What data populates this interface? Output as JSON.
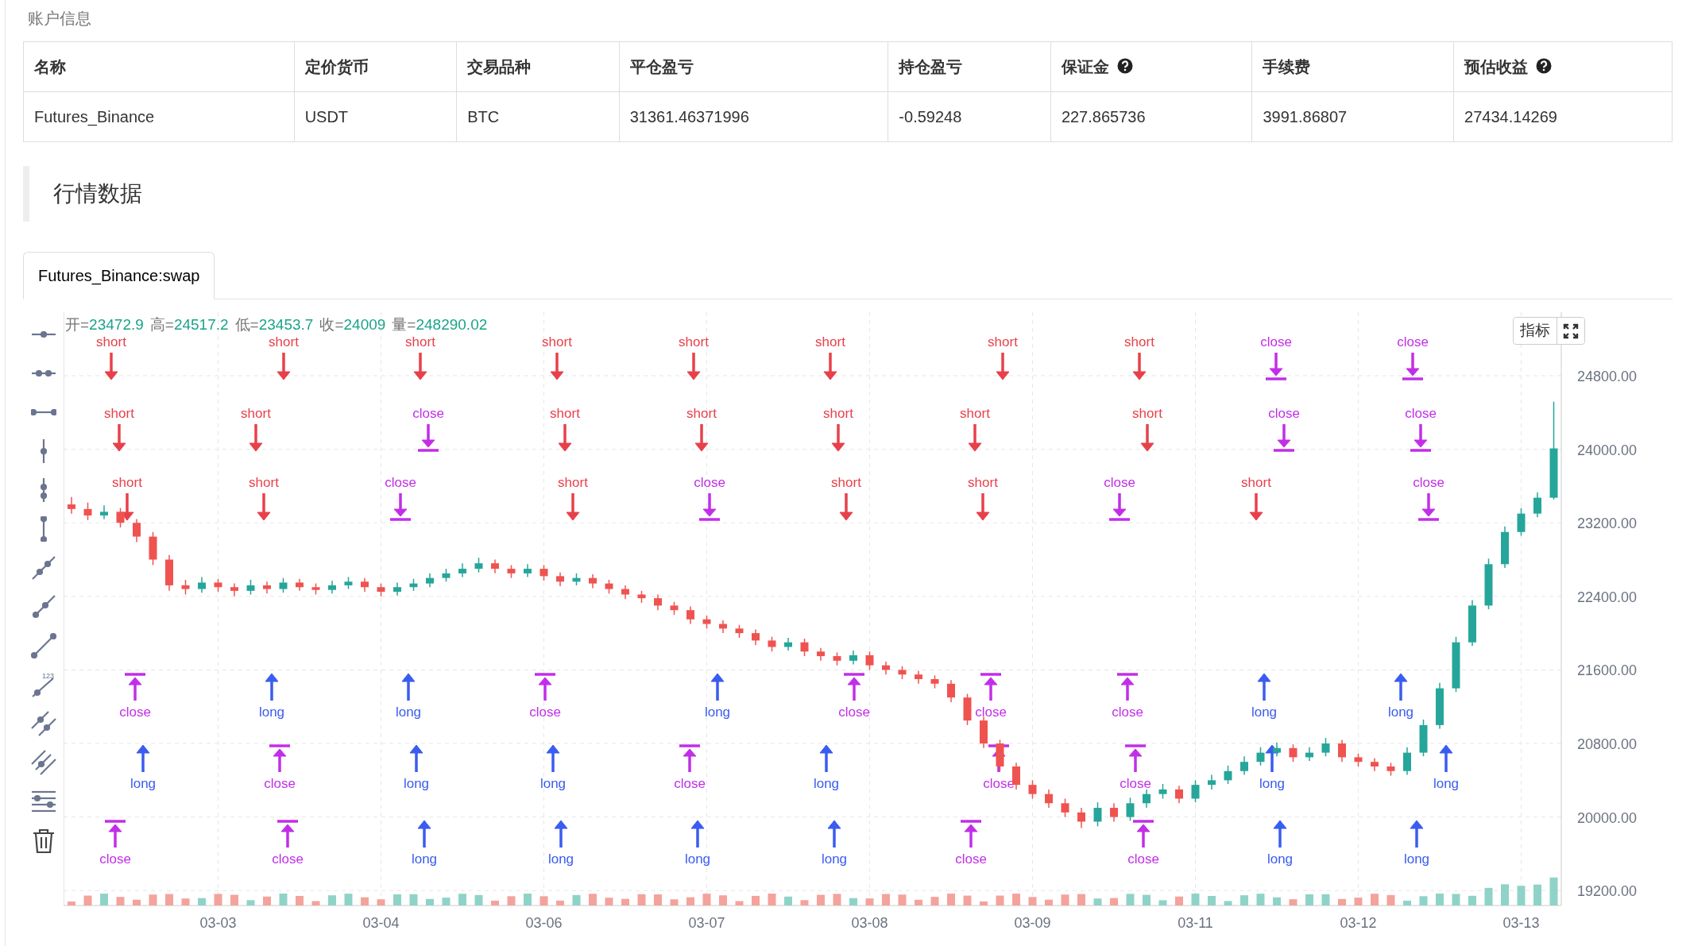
{
  "account": {
    "title": "账户信息",
    "columns": [
      {
        "label": "名称",
        "help": false
      },
      {
        "label": "定价货币",
        "help": false
      },
      {
        "label": "交易品种",
        "help": false
      },
      {
        "label": "平仓盈亏",
        "help": false
      },
      {
        "label": "持仓盈亏",
        "help": false
      },
      {
        "label": "保证金",
        "help": true
      },
      {
        "label": "手续费",
        "help": false
      },
      {
        "label": "预估收益",
        "help": true
      }
    ],
    "rows": [
      [
        "Futures_Binance",
        "USDT",
        "BTC",
        "31361.46371996",
        "-0.59248",
        "227.865736",
        "3991.86807",
        "27434.14269"
      ]
    ]
  },
  "market": {
    "title": "行情数据",
    "tabs": [
      {
        "label": "Futures_Binance:swap",
        "selected": true
      }
    ],
    "toolbar": {
      "fib_label": "123"
    },
    "indicator_button": "指标",
    "legend": [
      {
        "label": "开=",
        "value": "23472.9"
      },
      {
        "label": "高=",
        "value": "24517.2"
      },
      {
        "label": "低=",
        "value": "23453.7"
      },
      {
        "label": "收=",
        "value": "24009"
      },
      {
        "label": "量=",
        "value": "248290.02"
      }
    ],
    "chart_data": {
      "type": "candlestick",
      "categories": [
        null,
        null,
        null,
        null,
        null,
        null,
        null,
        null,
        null,
        "03-03",
        null,
        null,
        null,
        null,
        null,
        null,
        null,
        null,
        null,
        "03-04",
        null,
        null,
        null,
        null,
        null,
        null,
        null,
        null,
        null,
        "03-06",
        null,
        null,
        null,
        null,
        null,
        null,
        null,
        null,
        null,
        "03-07",
        null,
        null,
        null,
        null,
        null,
        null,
        null,
        null,
        null,
        "03-08",
        null,
        null,
        null,
        null,
        null,
        null,
        null,
        null,
        null,
        "03-09",
        null,
        null,
        null,
        null,
        null,
        null,
        null,
        null,
        null,
        "03-11",
        null,
        null,
        null,
        null,
        null,
        null,
        null,
        null,
        null,
        "03-12",
        null,
        null,
        null,
        null,
        null,
        null,
        null,
        null,
        null,
        "03-13",
        null,
        null
      ],
      "ylim": [
        19038,
        25491
      ],
      "grid": true,
      "ohlc": [
        [
          23400,
          23480,
          23300,
          23350
        ],
        [
          23350,
          23420,
          23230,
          23280
        ],
        [
          23280,
          23390,
          23240,
          23320
        ],
        [
          23320,
          23360,
          23150,
          23200
        ],
        [
          23200,
          23240,
          22990,
          23050
        ],
        [
          23050,
          23100,
          22740,
          22800
        ],
        [
          22800,
          22850,
          22460,
          22520
        ],
        [
          22520,
          22580,
          22420,
          22480
        ],
        [
          22480,
          22610,
          22440,
          22550
        ],
        [
          22550,
          22590,
          22450,
          22500
        ],
        [
          22500,
          22540,
          22400,
          22460
        ],
        [
          22460,
          22580,
          22420,
          22520
        ],
        [
          22520,
          22560,
          22430,
          22480
        ],
        [
          22480,
          22600,
          22440,
          22550
        ],
        [
          22550,
          22590,
          22460,
          22500
        ],
        [
          22500,
          22540,
          22420,
          22470
        ],
        [
          22470,
          22570,
          22430,
          22520
        ],
        [
          22520,
          22610,
          22480,
          22560
        ],
        [
          22560,
          22600,
          22450,
          22500
        ],
        [
          22500,
          22540,
          22400,
          22450
        ],
        [
          22450,
          22550,
          22410,
          22500
        ],
        [
          22500,
          22590,
          22460,
          22540
        ],
        [
          22540,
          22650,
          22500,
          22600
        ],
        [
          22600,
          22700,
          22560,
          22650
        ],
        [
          22650,
          22760,
          22610,
          22700
        ],
        [
          22700,
          22820,
          22660,
          22760
        ],
        [
          22760,
          22800,
          22650,
          22700
        ],
        [
          22700,
          22740,
          22600,
          22650
        ],
        [
          22650,
          22750,
          22610,
          22700
        ],
        [
          22700,
          22740,
          22570,
          22620
        ],
        [
          22620,
          22660,
          22510,
          22560
        ],
        [
          22560,
          22650,
          22520,
          22600
        ],
        [
          22600,
          22640,
          22490,
          22540
        ],
        [
          22540,
          22580,
          22430,
          22480
        ],
        [
          22480,
          22520,
          22370,
          22420
        ],
        [
          22420,
          22460,
          22330,
          22380
        ],
        [
          22380,
          22420,
          22250,
          22300
        ],
        [
          22300,
          22340,
          22200,
          22250
        ],
        [
          22250,
          22290,
          22100,
          22150
        ],
        [
          22150,
          22190,
          22050,
          22100
        ],
        [
          22100,
          22140,
          22000,
          22050
        ],
        [
          22050,
          22090,
          21950,
          22000
        ],
        [
          22000,
          22040,
          21870,
          21920
        ],
        [
          21920,
          21960,
          21800,
          21850
        ],
        [
          21850,
          21950,
          21810,
          21900
        ],
        [
          21900,
          21940,
          21750,
          21800
        ],
        [
          21800,
          21840,
          21700,
          21750
        ],
        [
          21750,
          21790,
          21650,
          21700
        ],
        [
          21700,
          21810,
          21660,
          21760
        ],
        [
          21760,
          21800,
          21600,
          21650
        ],
        [
          21650,
          21690,
          21550,
          21600
        ],
        [
          21600,
          21640,
          21500,
          21550
        ],
        [
          21550,
          21590,
          21450,
          21500
        ],
        [
          21500,
          21540,
          21400,
          21450
        ],
        [
          21450,
          21490,
          21250,
          21300
        ],
        [
          21300,
          21340,
          21000,
          21050
        ],
        [
          21050,
          21090,
          20750,
          20800
        ],
        [
          20800,
          20840,
          20500,
          20550
        ],
        [
          20550,
          20590,
          20300,
          20350
        ],
        [
          20350,
          20400,
          20200,
          20250
        ],
        [
          20250,
          20300,
          20100,
          20150
        ],
        [
          20150,
          20200,
          20000,
          20050
        ],
        [
          20050,
          20100,
          19880,
          19950
        ],
        [
          19950,
          20160,
          19900,
          20100
        ],
        [
          20100,
          20150,
          19950,
          20000
        ],
        [
          20000,
          20210,
          19960,
          20150
        ],
        [
          20150,
          20300,
          20100,
          20250
        ],
        [
          20250,
          20360,
          20200,
          20300
        ],
        [
          20300,
          20340,
          20150,
          20200
        ],
        [
          20200,
          20400,
          20160,
          20350
        ],
        [
          20350,
          20460,
          20300,
          20400
        ],
        [
          20400,
          20560,
          20360,
          20500
        ],
        [
          20500,
          20660,
          20460,
          20600
        ],
        [
          20600,
          20760,
          20560,
          20700
        ],
        [
          20700,
          20810,
          20660,
          20750
        ],
        [
          20750,
          20790,
          20600,
          20650
        ],
        [
          20650,
          20760,
          20610,
          20700
        ],
        [
          20700,
          20860,
          20660,
          20800
        ],
        [
          20800,
          20840,
          20600,
          20650
        ],
        [
          20650,
          20690,
          20550,
          20600
        ],
        [
          20600,
          20640,
          20500,
          20550
        ],
        [
          20550,
          20590,
          20450,
          20500
        ],
        [
          20500,
          20760,
          20460,
          20700
        ],
        [
          20700,
          21060,
          20660,
          21000
        ],
        [
          21000,
          21460,
          20960,
          21400
        ],
        [
          21400,
          21960,
          21360,
          21900
        ],
        [
          21900,
          22360,
          21860,
          22300
        ],
        [
          22300,
          22810,
          22260,
          22750
        ],
        [
          22750,
          23160,
          22710,
          23100
        ],
        [
          23100,
          23360,
          23060,
          23300
        ],
        [
          23300,
          23530,
          23260,
          23472.9
        ],
        [
          23472.9,
          24517.2,
          23453.7,
          24009
        ]
      ],
      "yticks": [
        {
          "value": 24800,
          "label": "24800.00"
        },
        {
          "value": 24000,
          "label": "24000.00"
        },
        {
          "value": 23200,
          "label": "23200.00"
        },
        {
          "value": 22400,
          "label": "22400.00"
        },
        {
          "value": 21600,
          "label": "21600.00"
        },
        {
          "value": 20800,
          "label": "20800.00"
        },
        {
          "value": 20000,
          "label": "20000.00"
        },
        {
          "value": 19200,
          "label": "19200.00"
        }
      ]
    },
    "markers": [
      {
        "kind": "short",
        "label": "short"
      },
      {
        "kind": "short",
        "label": "short"
      },
      {
        "kind": "short",
        "label": "short"
      },
      {
        "kind": "short",
        "label": "short"
      },
      {
        "kind": "short",
        "label": "short"
      },
      {
        "kind": "short",
        "label": "short"
      },
      {
        "kind": "short",
        "label": "short"
      },
      {
        "kind": "short",
        "label": "short"
      },
      {
        "kind": "close",
        "label": "close"
      },
      {
        "kind": "close",
        "label": "close"
      },
      {
        "kind": "short",
        "label": "short"
      },
      {
        "kind": "short",
        "label": "short"
      },
      {
        "kind": "close",
        "label": "close"
      },
      {
        "kind": "short",
        "label": "short"
      },
      {
        "kind": "short",
        "label": "short"
      },
      {
        "kind": "short",
        "label": "short"
      },
      {
        "kind": "short",
        "label": "short"
      },
      {
        "kind": "short",
        "label": "short"
      },
      {
        "kind": "close",
        "label": "close"
      },
      {
        "kind": "close",
        "label": "close"
      },
      {
        "kind": "short",
        "label": "short"
      },
      {
        "kind": "short",
        "label": "short"
      },
      {
        "kind": "close",
        "label": "close"
      },
      {
        "kind": "short",
        "label": "short"
      },
      {
        "kind": "close",
        "label": "close"
      },
      {
        "kind": "short",
        "label": "short"
      },
      {
        "kind": "short",
        "label": "short"
      },
      {
        "kind": "close",
        "label": "close"
      },
      {
        "kind": "short",
        "label": "short"
      },
      {
        "kind": "close",
        "label": "close"
      },
      {
        "kind": "close",
        "label": "close"
      },
      {
        "kind": "long",
        "label": "long"
      },
      {
        "kind": "long",
        "label": "long"
      },
      {
        "kind": "close",
        "label": "close"
      },
      {
        "kind": "long",
        "label": "long"
      },
      {
        "kind": "close",
        "label": "close"
      },
      {
        "kind": "close",
        "label": "close"
      },
      {
        "kind": "close",
        "label": "close"
      },
      {
        "kind": "long",
        "label": "long"
      },
      {
        "kind": "long",
        "label": "long"
      },
      {
        "kind": "long",
        "label": "long"
      },
      {
        "kind": "close",
        "label": "close"
      },
      {
        "kind": "long",
        "label": "long"
      },
      {
        "kind": "long",
        "label": "long"
      },
      {
        "kind": "close",
        "label": "close"
      },
      {
        "kind": "long",
        "label": "long"
      },
      {
        "kind": "close",
        "label": "close"
      },
      {
        "kind": "close",
        "label": "close"
      },
      {
        "kind": "long",
        "label": "long"
      },
      {
        "kind": "long",
        "label": "long"
      },
      {
        "kind": "close",
        "label": "close"
      },
      {
        "kind": "close",
        "label": "close"
      },
      {
        "kind": "long",
        "label": "long"
      },
      {
        "kind": "long",
        "label": "long"
      },
      {
        "kind": "long",
        "label": "long"
      },
      {
        "kind": "long",
        "label": "long"
      },
      {
        "kind": "close",
        "label": "close"
      },
      {
        "kind": "close",
        "label": "close"
      },
      {
        "kind": "long",
        "label": "long"
      },
      {
        "kind": "long",
        "label": "long"
      }
    ]
  }
}
